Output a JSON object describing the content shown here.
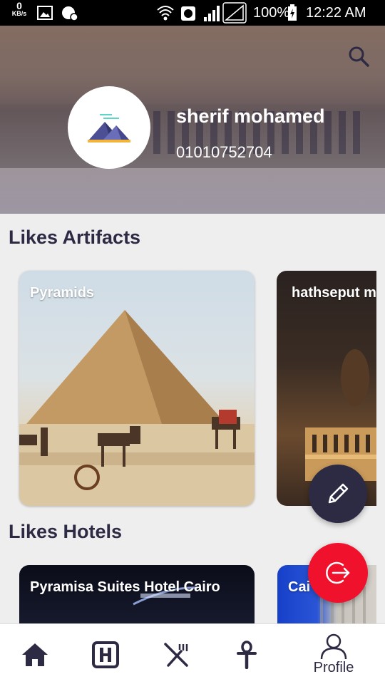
{
  "status_bar": {
    "net_speed_value": "0",
    "net_speed_unit": "KB/s",
    "battery": "100%",
    "time": "12:22 AM"
  },
  "header": {
    "user_name": "sherif mohamed",
    "phone": "01010752704",
    "search_icon": "search-icon"
  },
  "likes_artifacts": {
    "title": "Likes Artifacts",
    "cards": [
      {
        "name": "Pyramids"
      },
      {
        "name": "hathseput m"
      }
    ]
  },
  "likes_hotels": {
    "title": "Likes Hotels",
    "cards": [
      {
        "name": "Pyramisa Suites Hotel Cairo"
      },
      {
        "name": "Cai"
      }
    ]
  },
  "fabs": {
    "edit_icon": "pencil-icon",
    "logout_icon": "logout-icon",
    "accent_dark": "#2d2a44",
    "accent_red": "#f0112c"
  },
  "bottom_nav": {
    "items": [
      {
        "icon": "home-icon"
      },
      {
        "icon": "hotel-icon"
      },
      {
        "icon": "restaurant-icon"
      },
      {
        "icon": "ankh-icon"
      },
      {
        "icon": "profile-icon",
        "label": "Profile"
      }
    ]
  }
}
